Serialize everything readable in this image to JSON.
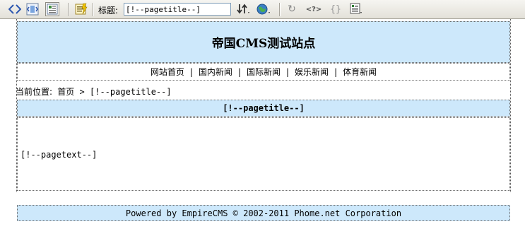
{
  "toolbar": {
    "title_label": "标题:",
    "title_value": "[!--pagetitle--]",
    "query_label": "<?>",
    "braces_label": "{}"
  },
  "page": {
    "site_title": "帝国CMS测试站点",
    "nav": [
      "网站首页",
      "国内新闻",
      "国际新闻",
      "娱乐新闻",
      "体育新闻"
    ],
    "nav_separator": "|",
    "breadcrumb": {
      "prefix": "当前位置:",
      "home": "首页",
      "arrow": ">",
      "current": "[!--pagetitle--]"
    },
    "content_title": "[!--pagetitle--]",
    "content_text": "[!--pagetext--]",
    "footer": "Powered by EmpireCMS © 2002-2011 Phome.net Corporation"
  },
  "colors": {
    "panel_blue": "#cde8fb",
    "toolbar_bg": "#e3e1d9"
  }
}
